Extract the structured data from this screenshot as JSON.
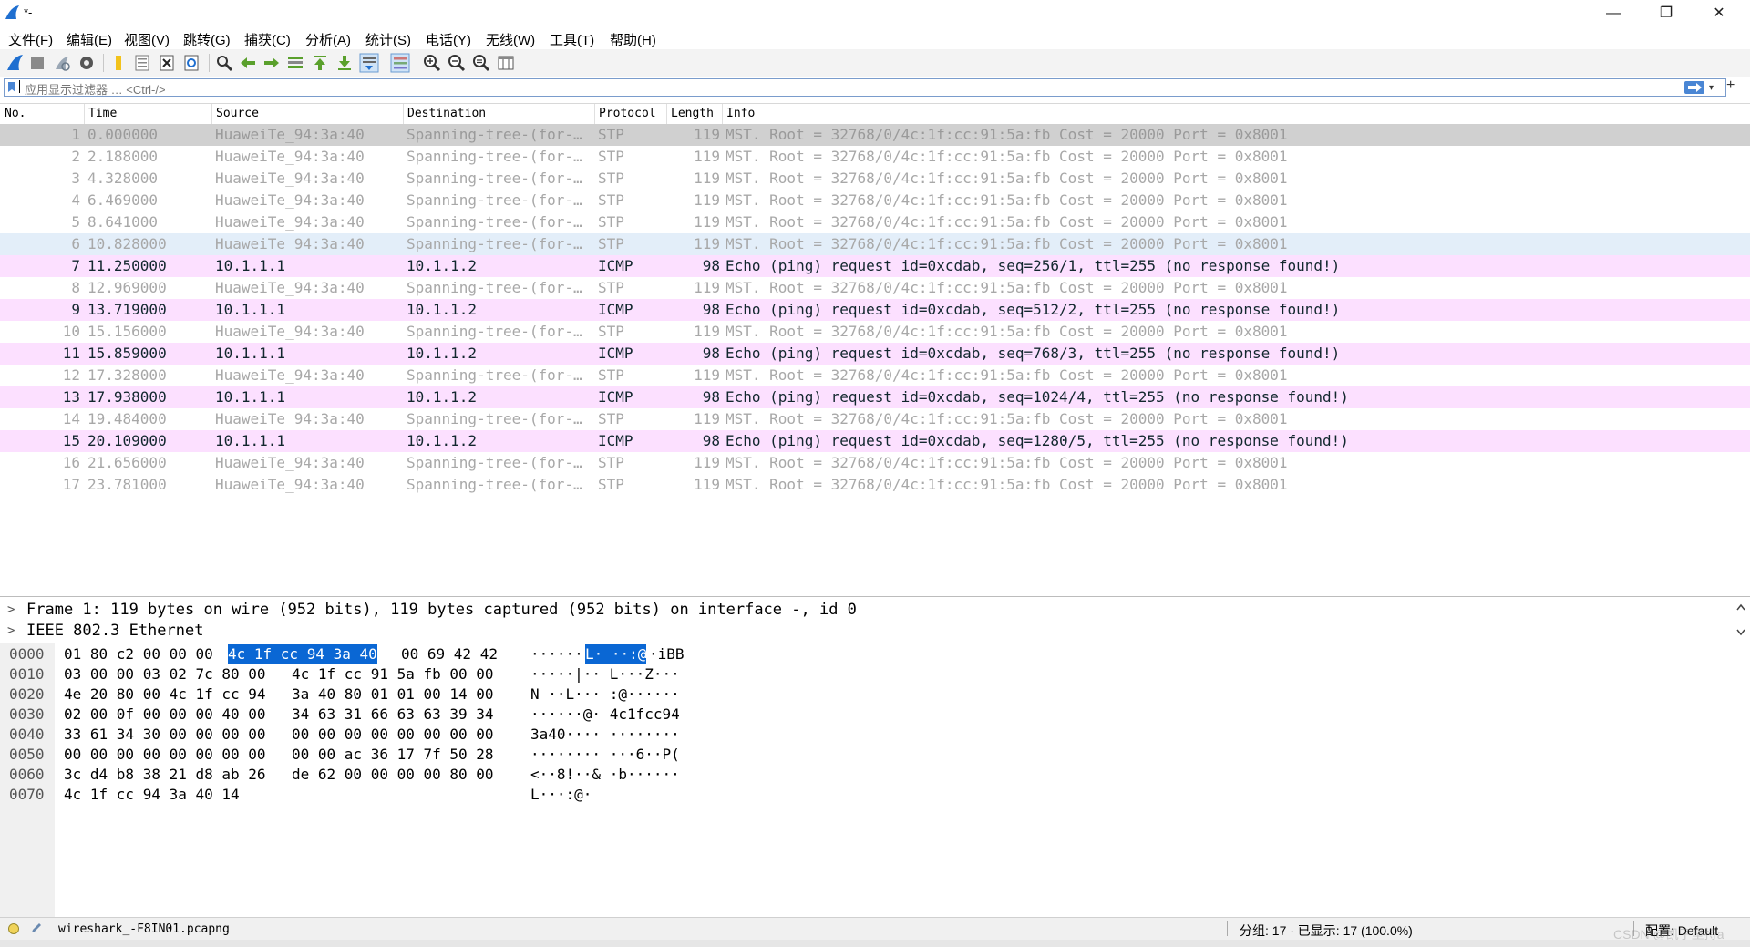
{
  "window": {
    "title": "*-",
    "minimize": "—",
    "maximize": "❐",
    "close": "✕"
  },
  "menu": [
    "文件(F)",
    "编辑(E)",
    "视图(V)",
    "跳转(G)",
    "捕获(C)",
    "分析(A)",
    "统计(S)",
    "电话(Y)",
    "无线(W)",
    "工具(T)",
    "帮助(H)"
  ],
  "toolbar_icons": [
    "wireshark-fin-icon",
    "stop-capture-icon",
    "restart-capture-icon",
    "capture-options-icon",
    "open-file-icon",
    "save-file-icon",
    "close-file-icon",
    "reload-icon",
    "find-packet-icon",
    "go-back-icon",
    "go-forward-icon",
    "go-to-packet-icon",
    "first-packet-icon",
    "last-packet-icon",
    "autoscroll-icon",
    "colorize-icon",
    "zoom-in-icon",
    "zoom-out-icon",
    "zoom-normal-icon",
    "resize-columns-icon"
  ],
  "filter": {
    "placeholder": "应用显示过滤器 … <Ctrl-/>",
    "dropdown": "▾",
    "plus": "+"
  },
  "columns": [
    "No.",
    "Time",
    "Source",
    "Destination",
    "Protocol",
    "Length",
    "Info"
  ],
  "packets": [
    {
      "no": "1",
      "time": "0.000000",
      "src": "HuaweiTe_94:3a:40",
      "dst": "Spanning-tree-(for-…",
      "proto": "STP",
      "len": "119",
      "info": "MST. Root = 32768/0/4c:1f:cc:91:5a:fb  Cost = 20000  Port = 0x8001",
      "kind": "stp",
      "state": "sel"
    },
    {
      "no": "2",
      "time": "2.188000",
      "src": "HuaweiTe_94:3a:40",
      "dst": "Spanning-tree-(for-…",
      "proto": "STP",
      "len": "119",
      "info": "MST. Root = 32768/0/4c:1f:cc:91:5a:fb  Cost = 20000  Port = 0x8001",
      "kind": "stp",
      "state": ""
    },
    {
      "no": "3",
      "time": "4.328000",
      "src": "HuaweiTe_94:3a:40",
      "dst": "Spanning-tree-(for-…",
      "proto": "STP",
      "len": "119",
      "info": "MST. Root = 32768/0/4c:1f:cc:91:5a:fb  Cost = 20000  Port = 0x8001",
      "kind": "stp",
      "state": ""
    },
    {
      "no": "4",
      "time": "6.469000",
      "src": "HuaweiTe_94:3a:40",
      "dst": "Spanning-tree-(for-…",
      "proto": "STP",
      "len": "119",
      "info": "MST. Root = 32768/0/4c:1f:cc:91:5a:fb  Cost = 20000  Port = 0x8001",
      "kind": "stp",
      "state": ""
    },
    {
      "no": "5",
      "time": "8.641000",
      "src": "HuaweiTe_94:3a:40",
      "dst": "Spanning-tree-(for-…",
      "proto": "STP",
      "len": "119",
      "info": "MST. Root = 32768/0/4c:1f:cc:91:5a:fb  Cost = 20000  Port = 0x8001",
      "kind": "stp",
      "state": ""
    },
    {
      "no": "6",
      "time": "10.828000",
      "src": "HuaweiTe_94:3a:40",
      "dst": "Spanning-tree-(for-…",
      "proto": "STP",
      "len": "119",
      "info": "MST. Root = 32768/0/4c:1f:cc:91:5a:fb  Cost = 20000  Port = 0x8001",
      "kind": "stp",
      "state": "hov"
    },
    {
      "no": "7",
      "time": "11.250000",
      "src": "10.1.1.1",
      "dst": "10.1.1.2",
      "proto": "ICMP",
      "len": "98",
      "info": "Echo (ping) request  id=0xcdab, seq=256/1, ttl=255 (no response found!)",
      "kind": "icmp",
      "state": ""
    },
    {
      "no": "8",
      "time": "12.969000",
      "src": "HuaweiTe_94:3a:40",
      "dst": "Spanning-tree-(for-…",
      "proto": "STP",
      "len": "119",
      "info": "MST. Root = 32768/0/4c:1f:cc:91:5a:fb  Cost = 20000  Port = 0x8001",
      "kind": "stp",
      "state": ""
    },
    {
      "no": "9",
      "time": "13.719000",
      "src": "10.1.1.1",
      "dst": "10.1.1.2",
      "proto": "ICMP",
      "len": "98",
      "info": "Echo (ping) request  id=0xcdab, seq=512/2, ttl=255 (no response found!)",
      "kind": "icmp",
      "state": ""
    },
    {
      "no": "10",
      "time": "15.156000",
      "src": "HuaweiTe_94:3a:40",
      "dst": "Spanning-tree-(for-…",
      "proto": "STP",
      "len": "119",
      "info": "MST. Root = 32768/0/4c:1f:cc:91:5a:fb  Cost = 20000  Port = 0x8001",
      "kind": "stp",
      "state": ""
    },
    {
      "no": "11",
      "time": "15.859000",
      "src": "10.1.1.1",
      "dst": "10.1.1.2",
      "proto": "ICMP",
      "len": "98",
      "info": "Echo (ping) request  id=0xcdab, seq=768/3, ttl=255 (no response found!)",
      "kind": "icmp",
      "state": ""
    },
    {
      "no": "12",
      "time": "17.328000",
      "src": "HuaweiTe_94:3a:40",
      "dst": "Spanning-tree-(for-…",
      "proto": "STP",
      "len": "119",
      "info": "MST. Root = 32768/0/4c:1f:cc:91:5a:fb  Cost = 20000  Port = 0x8001",
      "kind": "stp",
      "state": ""
    },
    {
      "no": "13",
      "time": "17.938000",
      "src": "10.1.1.1",
      "dst": "10.1.1.2",
      "proto": "ICMP",
      "len": "98",
      "info": "Echo (ping) request  id=0xcdab, seq=1024/4, ttl=255 (no response found!)",
      "kind": "icmp",
      "state": ""
    },
    {
      "no": "14",
      "time": "19.484000",
      "src": "HuaweiTe_94:3a:40",
      "dst": "Spanning-tree-(for-…",
      "proto": "STP",
      "len": "119",
      "info": "MST. Root = 32768/0/4c:1f:cc:91:5a:fb  Cost = 20000  Port = 0x8001",
      "kind": "stp",
      "state": ""
    },
    {
      "no": "15",
      "time": "20.109000",
      "src": "10.1.1.1",
      "dst": "10.1.1.2",
      "proto": "ICMP",
      "len": "98",
      "info": "Echo (ping) request  id=0xcdab, seq=1280/5, ttl=255 (no response found!)",
      "kind": "icmp",
      "state": ""
    },
    {
      "no": "16",
      "time": "21.656000",
      "src": "HuaweiTe_94:3a:40",
      "dst": "Spanning-tree-(for-…",
      "proto": "STP",
      "len": "119",
      "info": "MST. Root = 32768/0/4c:1f:cc:91:5a:fb  Cost = 20000  Port = 0x8001",
      "kind": "stp",
      "state": ""
    },
    {
      "no": "17",
      "time": "23.781000",
      "src": "HuaweiTe_94:3a:40",
      "dst": "Spanning-tree-(for-…",
      "proto": "STP",
      "len": "119",
      "info": "MST. Root = 32768/0/4c:1f:cc:91:5a:fb  Cost = 20000  Port = 0x8001",
      "kind": "stp",
      "state": ""
    }
  ],
  "details": [
    {
      "arrow": ">",
      "text": "Frame 1: 119 bytes on wire (952 bits), 119 bytes captured (952 bits) on interface -, id 0"
    },
    {
      "arrow": ">",
      "text": "IEEE 802.3 Ethernet"
    }
  ],
  "hex": [
    {
      "off": "0000",
      "a": "01 80 c2 00 00 00",
      "h": "4c 1f  cc 94 3a 40",
      "b": "00 69 42 42",
      "asc_pre": "······",
      "asc_hl": "L· ··:@",
      "asc_post": "·iBB"
    },
    {
      "off": "0010",
      "a": "03 00 00 03 02 7c 80 00",
      "h": "",
      "b": "4c 1f cc 91 5a fb 00 00",
      "asc_pre": "·····|··  L···Z···",
      "asc_hl": "",
      "asc_post": ""
    },
    {
      "off": "0020",
      "a": "4e 20 80 00 4c 1f cc 94",
      "h": "",
      "b": "3a 40 80 01 01 00 14 00",
      "asc_pre": "N ··L···  :@······",
      "asc_hl": "",
      "asc_post": ""
    },
    {
      "off": "0030",
      "a": "02 00 0f 00 00 00 40 00",
      "h": "",
      "b": "34 63 31 66 63 63 39 34",
      "asc_pre": "······@·  4c1fcc94",
      "asc_hl": "",
      "asc_post": ""
    },
    {
      "off": "0040",
      "a": "33 61 34 30 00 00 00 00",
      "h": "",
      "b": "00 00 00 00 00 00 00 00",
      "asc_pre": "3a40····  ········",
      "asc_hl": "",
      "asc_post": ""
    },
    {
      "off": "0050",
      "a": "00 00 00 00 00 00 00 00",
      "h": "",
      "b": "00 00 ac 36 17 7f 50 28",
      "asc_pre": "········  ···6··P(",
      "asc_hl": "",
      "asc_post": ""
    },
    {
      "off": "0060",
      "a": "3c d4 b8 38 21 d8 ab 26",
      "h": "",
      "b": "de 62 00 00 00 00 80 00",
      "asc_pre": "<··8!··&  ·b······",
      "asc_hl": "",
      "asc_post": ""
    },
    {
      "off": "0070",
      "a": "4c 1f cc 94 3a 40 14",
      "h": "",
      "b": "",
      "asc_pre": "L···:@·",
      "asc_hl": "",
      "asc_post": ""
    }
  ],
  "status": {
    "file": "wireshark_-F8IN01.pcapng",
    "stats": "分组: 17 · 已显示: 17 (100.0%)",
    "profile": "配置: Default",
    "watermark": "CSDN @凯子坚持a"
  },
  "colors": {
    "icmp_row": "#fce0ff",
    "selected_row": "#d0d0d0",
    "hex_highlight": "#0a67d4",
    "filter_border": "#7a9ccc"
  }
}
